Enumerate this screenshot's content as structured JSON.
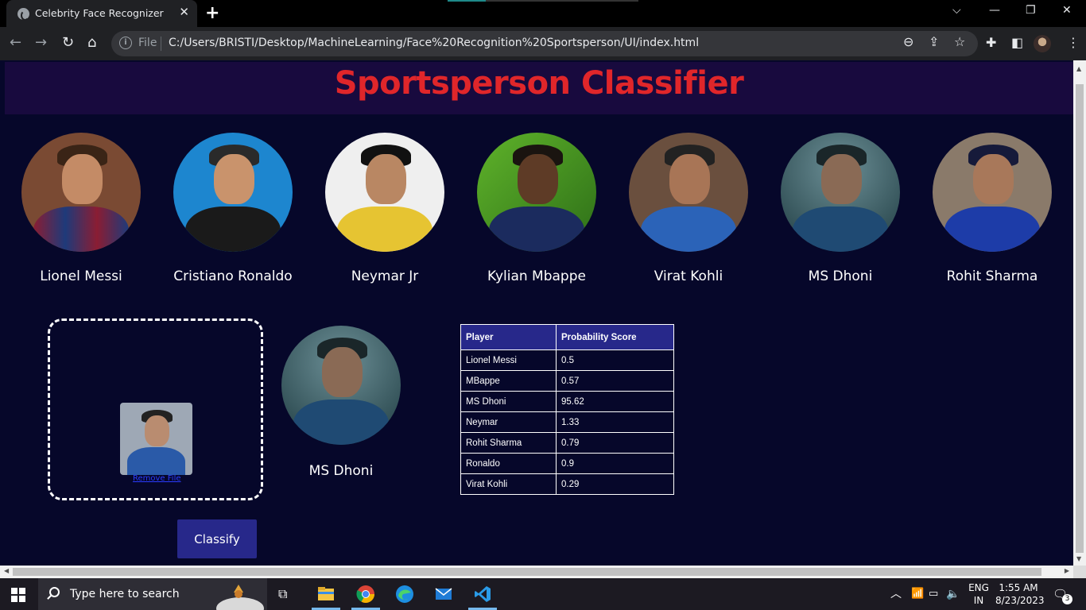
{
  "browser": {
    "tab_title": "Celebrity Face Recognizer",
    "tab_close": "✕",
    "new_tab": "+",
    "window_controls": {
      "dropdown": "⌵",
      "minimize": "—",
      "restore": "❐",
      "close": "✕"
    },
    "address": {
      "scheme_label": "File",
      "url": "C:/Users/BRISTI/Desktop/MachineLearning/Face%20Recognition%20Sportsperson/UI/index.html"
    }
  },
  "page": {
    "title": "Sportsperson Classifier",
    "players": [
      {
        "name": "Lionel Messi"
      },
      {
        "name": "Cristiano Ronaldo"
      },
      {
        "name": "Neymar Jr"
      },
      {
        "name": "Kylian Mbappe"
      },
      {
        "name": "Virat Kohli"
      },
      {
        "name": "MS Dhoni"
      },
      {
        "name": "Rohit Sharma"
      }
    ],
    "dropzone": {
      "remove_label": "Remove File"
    },
    "result": {
      "name": "MS Dhoni"
    },
    "classify_label": "Classify",
    "table": {
      "headers": [
        "Player",
        "Probability Score"
      ],
      "rows": [
        [
          "Lionel Messi",
          "0.5"
        ],
        [
          "MBappe",
          "0.57"
        ],
        [
          "MS Dhoni",
          "95.62"
        ],
        [
          "Neymar",
          "1.33"
        ],
        [
          "Rohit Sharma",
          "0.79"
        ],
        [
          "Ronaldo",
          "0.9"
        ],
        [
          "Virat Kohli",
          "0.29"
        ]
      ]
    }
  },
  "taskbar": {
    "search_placeholder": "Type here to search",
    "language": "ENG",
    "region": "IN",
    "time": "1:55 AM",
    "date": "8/23/2023",
    "notification_count": "3"
  },
  "colors": {
    "page_bg": "#06072a",
    "header_bg": "#180a3e",
    "title": "#e0262a",
    "accent": "#27288a"
  }
}
